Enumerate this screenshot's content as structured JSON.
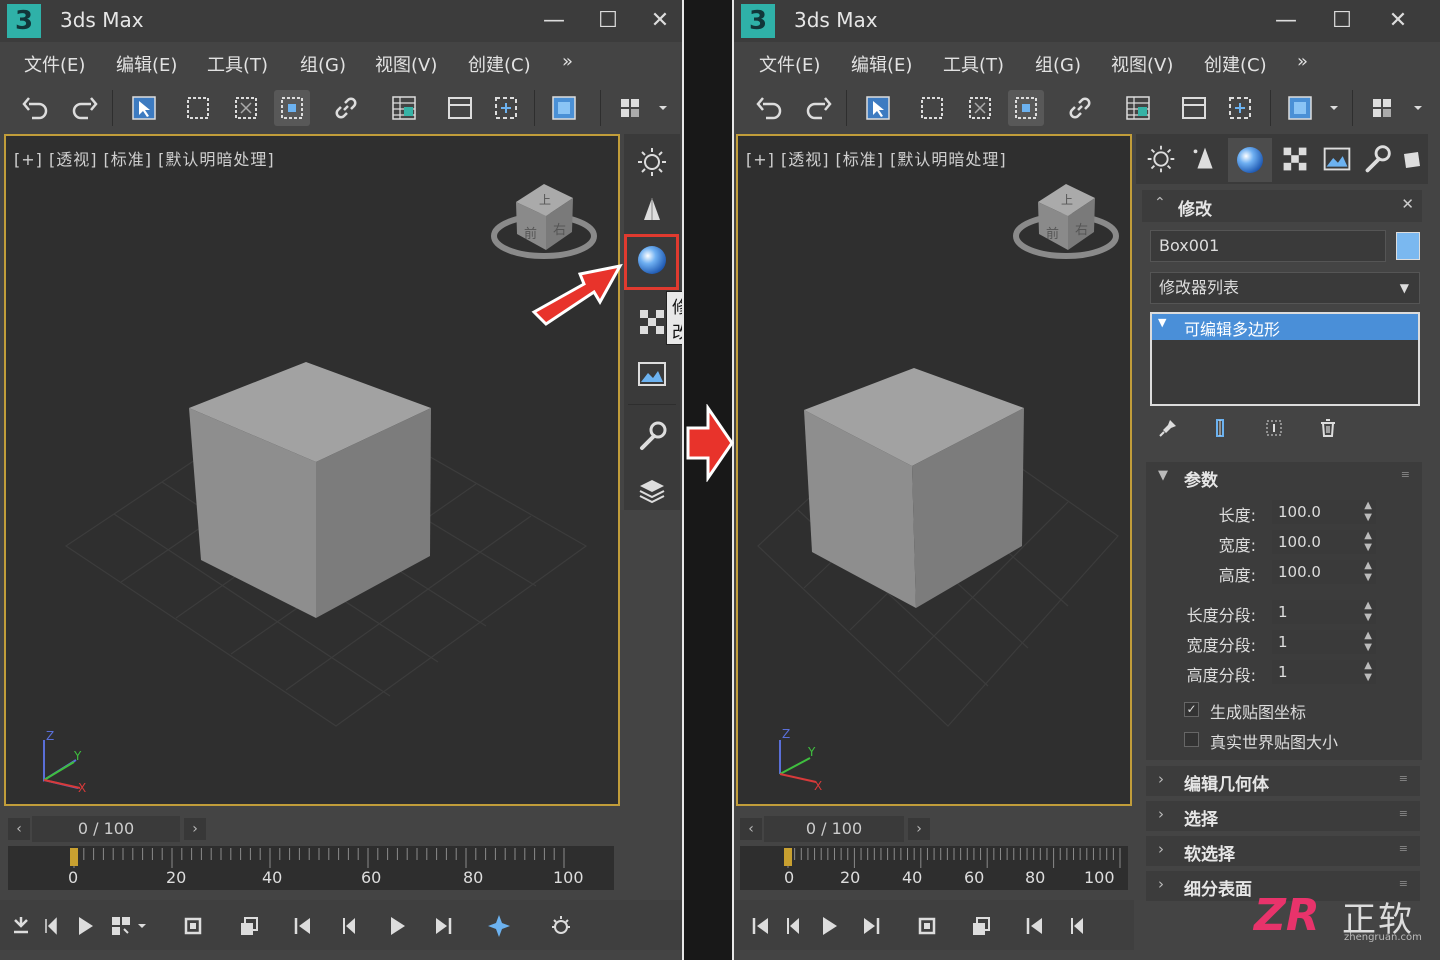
{
  "app": {
    "logo": "3",
    "title": "3ds Max"
  },
  "window_controls": {
    "minimize": "—",
    "maximize": "☐",
    "close": "✕"
  },
  "menu": [
    "文件(E)",
    "编辑(E)",
    "工具(T)",
    "组(G)",
    "视图(V)",
    "创建(C)",
    "»"
  ],
  "viewport": {
    "label": "[+] [透视] [标准] [默认明暗处理]",
    "cube_faces": {
      "top": "上",
      "front": "前",
      "right": "右"
    },
    "axes": {
      "x": "X",
      "y": "Y",
      "z": "Z"
    }
  },
  "command_panel_tabs": [
    "create-icon",
    "hierarchy-icon",
    "modify-icon",
    "motion-icon",
    "display-icon",
    "utilities-icon",
    "layers-icon"
  ],
  "tooltip": "修改",
  "timeline": {
    "frame": "0 / 100",
    "ticks": [
      "0",
      "20",
      "40",
      "60",
      "80",
      "100"
    ],
    "prev": "‹",
    "next": "›"
  },
  "modify_panel": {
    "title": "修改",
    "close": "✕",
    "object_name": "Box001",
    "object_color": "#7ab8f0",
    "modifier_list": "修改器列表",
    "stack_item": "可编辑多边形",
    "params_title": "参数",
    "params": [
      {
        "label": "长度:",
        "value": "100.0"
      },
      {
        "label": "宽度:",
        "value": "100.0"
      },
      {
        "label": "高度:",
        "value": "100.0"
      },
      {
        "label": "长度分段:",
        "value": "1"
      },
      {
        "label": "宽度分段:",
        "value": "1"
      },
      {
        "label": "高度分段:",
        "value": "1"
      }
    ],
    "checkboxes": [
      {
        "label": "生成贴图坐标",
        "checked": true
      },
      {
        "label": "真实世界贴图大小",
        "checked": false
      }
    ],
    "rollouts": [
      "编辑几何体",
      "选择",
      "软选择",
      "细分表面"
    ]
  },
  "watermark": {
    "logo": "ZR",
    "name": "正软",
    "url": "zhengruan.com"
  },
  "colors": {
    "highlight": "#e03a2f",
    "viewport_border": "#c19d3a",
    "selection_blue": "#4a8fd8",
    "arrow_red": "#e8332b"
  }
}
